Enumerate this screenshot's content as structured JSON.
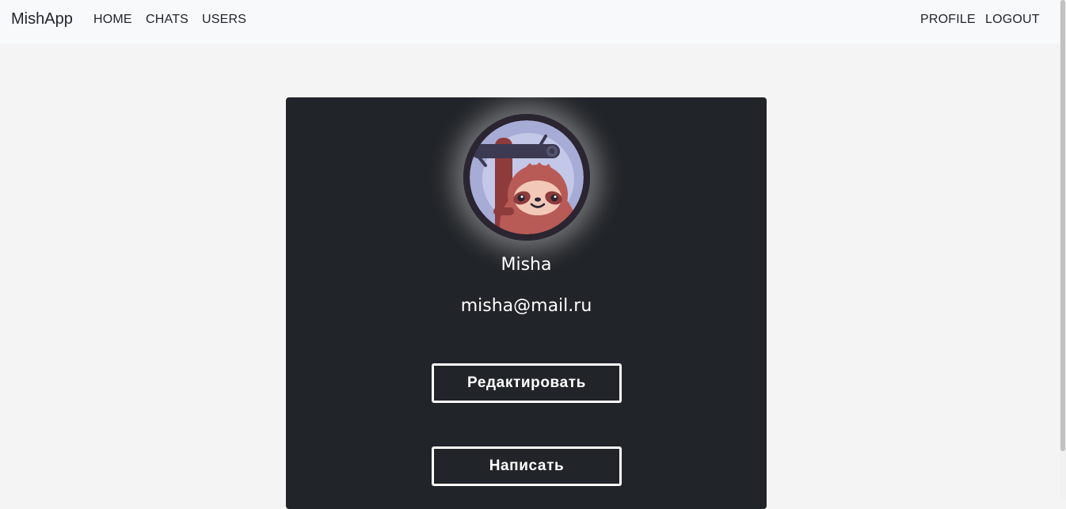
{
  "navbar": {
    "brand": "MishApp",
    "left_links": [
      "HOME",
      "CHATS",
      "USERS"
    ],
    "right_links": [
      "PROFILE",
      "LOGOUT"
    ]
  },
  "profile": {
    "avatar_icon": "sloth-avatar-icon",
    "name": "Misha",
    "email": "misha@mail.ru",
    "edit_button": "Редактировать",
    "message_button": "Написать"
  },
  "colors": {
    "page_bg": "#f4f4f4",
    "navbar_bg": "#f8f9fa",
    "card_bg": "#212428",
    "text_light": "#ffffff"
  }
}
